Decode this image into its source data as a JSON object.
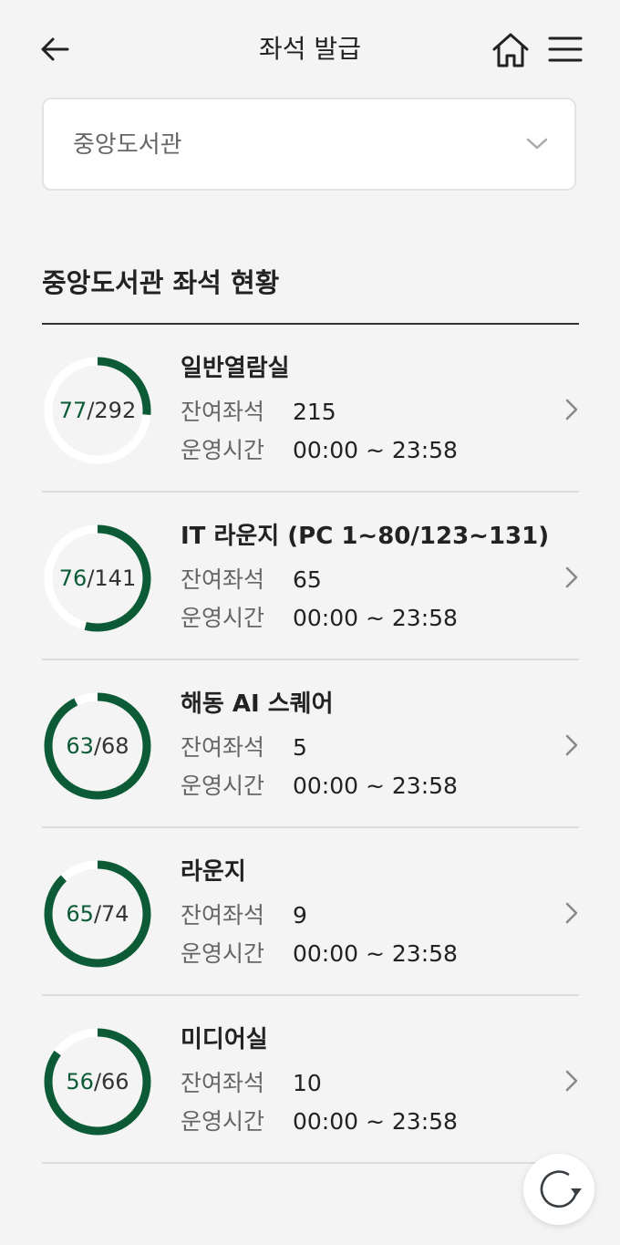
{
  "header": {
    "title": "좌석 발급",
    "back_icon": "arrow-left-icon",
    "home_icon": "home-icon",
    "menu_icon": "hamburger-menu-icon"
  },
  "library_select": {
    "value": "중앙도서관",
    "icon": "chevron-down-icon"
  },
  "section": {
    "title": "중앙도서관 좌석 현황"
  },
  "rooms": [
    {
      "name": "일반열람실",
      "used": 77,
      "total": 292,
      "used_label": "77",
      "total_label": "/292",
      "remaining_label": "잔여좌석",
      "remaining": "215",
      "hours_label": "운영시간",
      "hours": "00:00 ~ 23:58"
    },
    {
      "name": "IT 라운지 (PC 1~80/123~131)",
      "used": 76,
      "total": 141,
      "used_label": "76",
      "total_label": "/141",
      "remaining_label": "잔여좌석",
      "remaining": "65",
      "hours_label": "운영시간",
      "hours": "00:00 ~ 23:58"
    },
    {
      "name": "해동 AI 스퀘어",
      "used": 63,
      "total": 68,
      "used_label": "63",
      "total_label": "/68",
      "remaining_label": "잔여좌석",
      "remaining": "5",
      "hours_label": "운영시간",
      "hours": "00:00 ~ 23:58"
    },
    {
      "name": "라운지",
      "used": 65,
      "total": 74,
      "used_label": "65",
      "total_label": "/74",
      "remaining_label": "잔여좌석",
      "remaining": "9",
      "hours_label": "운영시간",
      "hours": "00:00 ~ 23:58"
    },
    {
      "name": "미디어실",
      "used": 56,
      "total": 66,
      "used_label": "56",
      "total_label": "/66",
      "remaining_label": "잔여좌석",
      "remaining": "10",
      "hours_label": "운영시간",
      "hours": "00:00 ~ 23:58"
    }
  ],
  "refresh": {
    "icon": "refresh-icon"
  },
  "colors": {
    "accent": "#0d5b36",
    "gauge_track": "#ffffff",
    "background": "#f4f4f4"
  }
}
